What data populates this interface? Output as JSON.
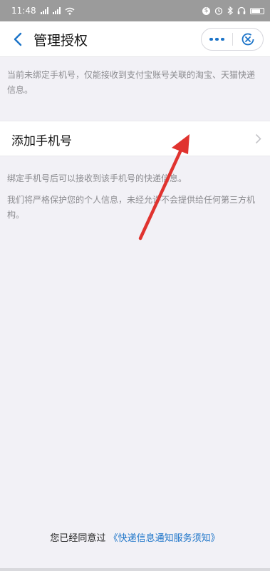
{
  "status_bar": {
    "time": "11:48",
    "signal_label_1": "Sill",
    "signal_label_2": "Sill"
  },
  "nav": {
    "title": "管理授权"
  },
  "notice": "当前未绑定手机号，仅能接收到支付宝账号关联的淘宝、天猫快递信息。",
  "add_phone_label": "添加手机号",
  "info": {
    "line1": "绑定手机号后可以接收到该手机号的快递信息。",
    "line2": "我们将严格保护您的个人信息，未经允许不会提供给任何第三方机构。"
  },
  "footer": {
    "prefix": "您已经同意过",
    "link": "《快递信息通知服务须知》"
  },
  "colors": {
    "accent": "#1a73c8",
    "annotation_arrow": "#e0332f",
    "status_bar_bg": "#9b9b9b",
    "page_bg": "#f2f1f6"
  }
}
